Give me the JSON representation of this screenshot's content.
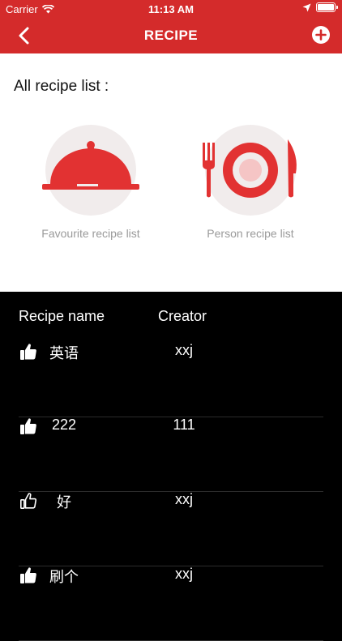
{
  "status_bar": {
    "carrier": "Carrier",
    "time": "11:13 AM"
  },
  "navbar": {
    "title": "RECIPE"
  },
  "main": {
    "section_title": "All recipe list :",
    "categories": [
      {
        "label": "Favourite recipe list",
        "icon": "cloche-icon"
      },
      {
        "label": "Person recipe list",
        "icon": "plate-cutlery-icon"
      }
    ]
  },
  "table": {
    "headers": {
      "name": "Recipe name",
      "creator": "Creator"
    },
    "rows": [
      {
        "name": "英语",
        "creator": "xxj",
        "liked": true
      },
      {
        "name": "222",
        "creator": "111",
        "liked": true
      },
      {
        "name": "好",
        "creator": "xxj",
        "liked": false
      },
      {
        "name": "刷个",
        "creator": "xxj",
        "liked": true
      }
    ]
  },
  "colors": {
    "brand_red": "#d42b2b",
    "icon_red": "#e23232",
    "circle_bg": "#f1ecec",
    "table_bg": "#000000"
  }
}
